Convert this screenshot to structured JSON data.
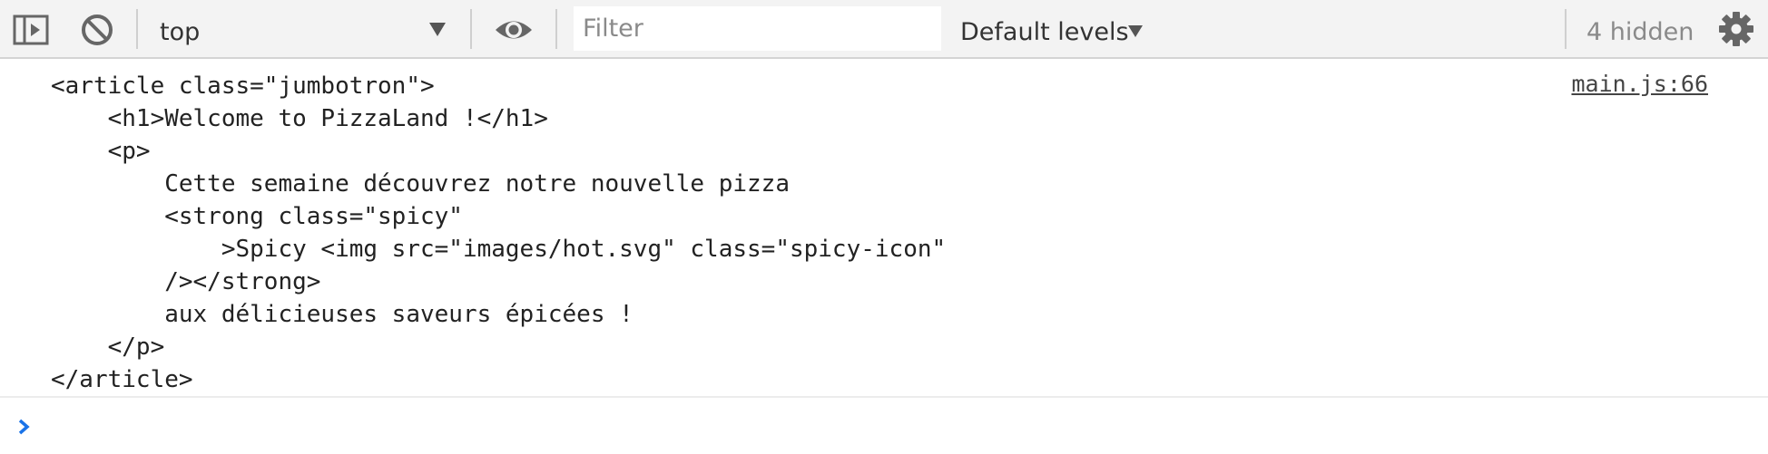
{
  "toolbar": {
    "context": "top",
    "filter_placeholder": "Filter",
    "levels_label": "Default levels",
    "hidden_count": "4 hidden"
  },
  "icons": {
    "sidebar": "sidebar-toggle-icon",
    "clear": "clear-console-icon",
    "context_arrow": "triangle-down-icon",
    "live_expression": "eye-icon",
    "levels_arrow": "triangle-down-icon",
    "settings": "gear-icon",
    "prompt": "chevron-right-icon"
  },
  "colors": {
    "toolbar_bg": "#f3f3f3",
    "prompt_accent": "#1a73e8"
  },
  "console": {
    "entries": [
      {
        "source": "main.js:66",
        "lines": [
          "<article class=\"jumbotron\">",
          "    <h1>Welcome to PizzaLand !</h1>",
          "    <p>",
          "        Cette semaine découvrez notre nouvelle pizza",
          "        <strong class=\"spicy\"",
          "            >Spicy <img src=\"images/hot.svg\" class=\"spicy-icon\"",
          "        /></strong>",
          "        aux délicieuses saveurs épicées !",
          "    </p>",
          "</article>"
        ]
      }
    ],
    "prompt_value": ""
  }
}
